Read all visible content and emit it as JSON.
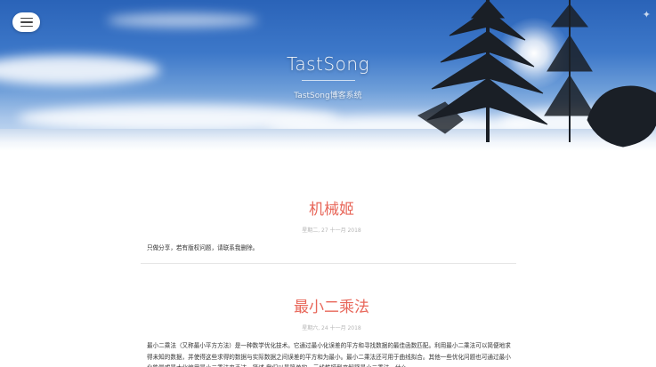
{
  "header": {
    "site_title": "TastSong",
    "site_subtitle": "TastSong博客系统",
    "menu_icon": "hamburger-menu-icon"
  },
  "posts": [
    {
      "title": "机械姬",
      "date": "星期二, 27 十一月 2018",
      "excerpt": "只做分享，若有版权问题，请联系我删除。"
    },
    {
      "title": "最小二乘法",
      "date": "星期六, 24 十一月 2018",
      "excerpt": "最小二乘法（又称最小平方方法）是一种数学优化技术。它通过最小化误差的平方和寻找数据的最佳函数匹配。利用最小二乘法可以简便地求得未知的数据，并使得这些求得的数据与实际数据之间误差的平方和为最小。最小二乘法还可用于曲线拟合。其他一些优化问题也可通过最小化能量或最大化熵用最小二乘法来表达。简述 我们以最简单的一元线性模型来解释最小二乘法。什么"
    }
  ],
  "colors": {
    "post_title": "#e8675a",
    "date_text": "#b5b5b5",
    "body_text": "#333333"
  }
}
